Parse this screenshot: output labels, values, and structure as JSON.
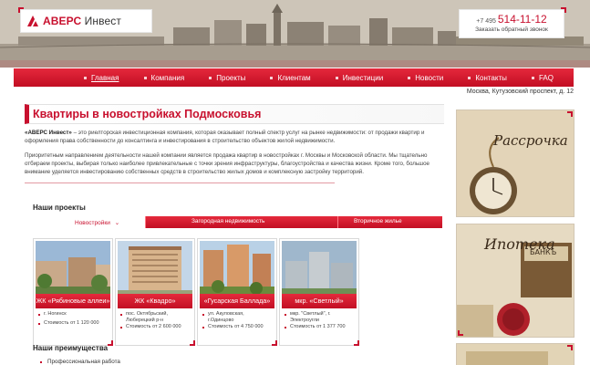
{
  "header": {
    "logo_brand": "АВЕРС",
    "logo_name": "Инвест",
    "phone_prefix": "+7 495",
    "phone_number": "514-11-12",
    "callback_link": "Заказать обратный звонок"
  },
  "nav": {
    "items": [
      {
        "label": "Главная",
        "active": true
      },
      {
        "label": "Компания"
      },
      {
        "label": "Проекты"
      },
      {
        "label": "Клиентам"
      },
      {
        "label": "Инвестиции"
      },
      {
        "label": "Новости"
      },
      {
        "label": "Контакты"
      },
      {
        "label": "FAQ"
      }
    ]
  },
  "address": "Москва, Кутузовский проспект, д. 12",
  "main": {
    "title": "Квартиры в новостройках Подмосковья",
    "intro_bold": "«АВЕРС Инвест»",
    "intro_p1": " – это риелторская инвестиционная компания, которая оказывает полный спектр услуг на рынке недвижимости: от продажи квартир и оформления права собственности до консалтинга и инвестирования в строительство объектов жилой недвижимости.",
    "intro_p2": "Приоритетным направлением деятельности нашей компании является продажа квартир в новостройках г. Москвы и Московской области. Мы тщательно отбираем проекты, выбирая только наиболее привлекательные с точки зрения инфраструктуры, благоустройства и качества жизни. Кроме того, большое внимание уделяется инвестированию собственных средств в строительство жилых домов и комплексную застройку территорий.",
    "projects_title": "Наши проекты",
    "project_tabs": [
      "Новостройки",
      "Загородная недвижимость",
      "Вторичное жилье"
    ],
    "benefits_title": "Наши преимущества",
    "benefits": [
      "Профессиональная работа"
    ]
  },
  "cards": [
    {
      "name": "ЖК «Рябиновые аллеи»",
      "address": "г. Ногинск",
      "price": "Стоимость от 1 120 000"
    },
    {
      "name": "ЖК «Квадро»",
      "address": "пос. Октябрьский,",
      "address2": "Люберецкий р-н",
      "price": "Стоимость от 2 600 000"
    },
    {
      "name": "«Гусарская Баллада»",
      "address": "ул. Акуловская,",
      "address2": "г.Одинцово",
      "price": "Стоимость от 4 750 000"
    },
    {
      "name": "мкр. «Светлый»",
      "address": "мкр. \"Светлый\", г.",
      "address2": "Электроугли",
      "price": "Стоимость от 1 377 700"
    }
  ],
  "banners": {
    "installment": "Рассрочка",
    "mortgage": "Ипотека",
    "bank_sign": "БАНКЪ"
  },
  "colors": {
    "accent": "#c8102e"
  }
}
